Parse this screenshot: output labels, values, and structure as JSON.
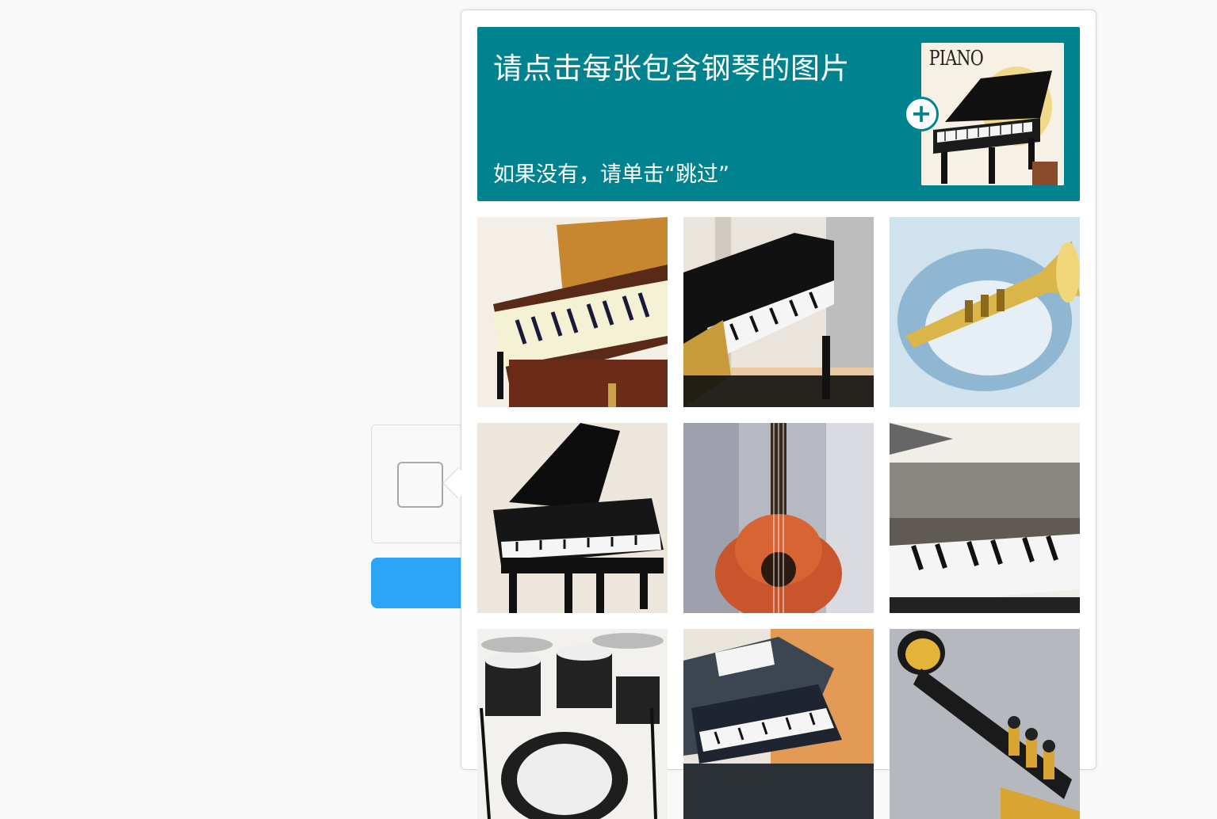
{
  "prompt": {
    "title": "请点击每张包含钢琴的图片",
    "subtitle": "如果没有，请单击“跳过”",
    "example_label": "PIANO",
    "background_color": "#00838f"
  },
  "example_badge": "+",
  "tiles": [
    {
      "name": "tile-grand-piano-brown",
      "subject": "piano"
    },
    {
      "name": "tile-upright-piano-room",
      "subject": "piano"
    },
    {
      "name": "tile-trumpet-blue",
      "subject": "trumpet"
    },
    {
      "name": "tile-black-grand-piano",
      "subject": "piano"
    },
    {
      "name": "tile-acoustic-guitar",
      "subject": "guitar"
    },
    {
      "name": "tile-upright-piano-grey",
      "subject": "piano"
    },
    {
      "name": "tile-drum-kit",
      "subject": "drums"
    },
    {
      "name": "tile-piano-orange",
      "subject": "piano"
    },
    {
      "name": "tile-trumpet-gold",
      "subject": "trumpet"
    }
  ],
  "colors": {
    "submit_button": "#2ba6f7",
    "page_background": "#f9f9f9"
  }
}
